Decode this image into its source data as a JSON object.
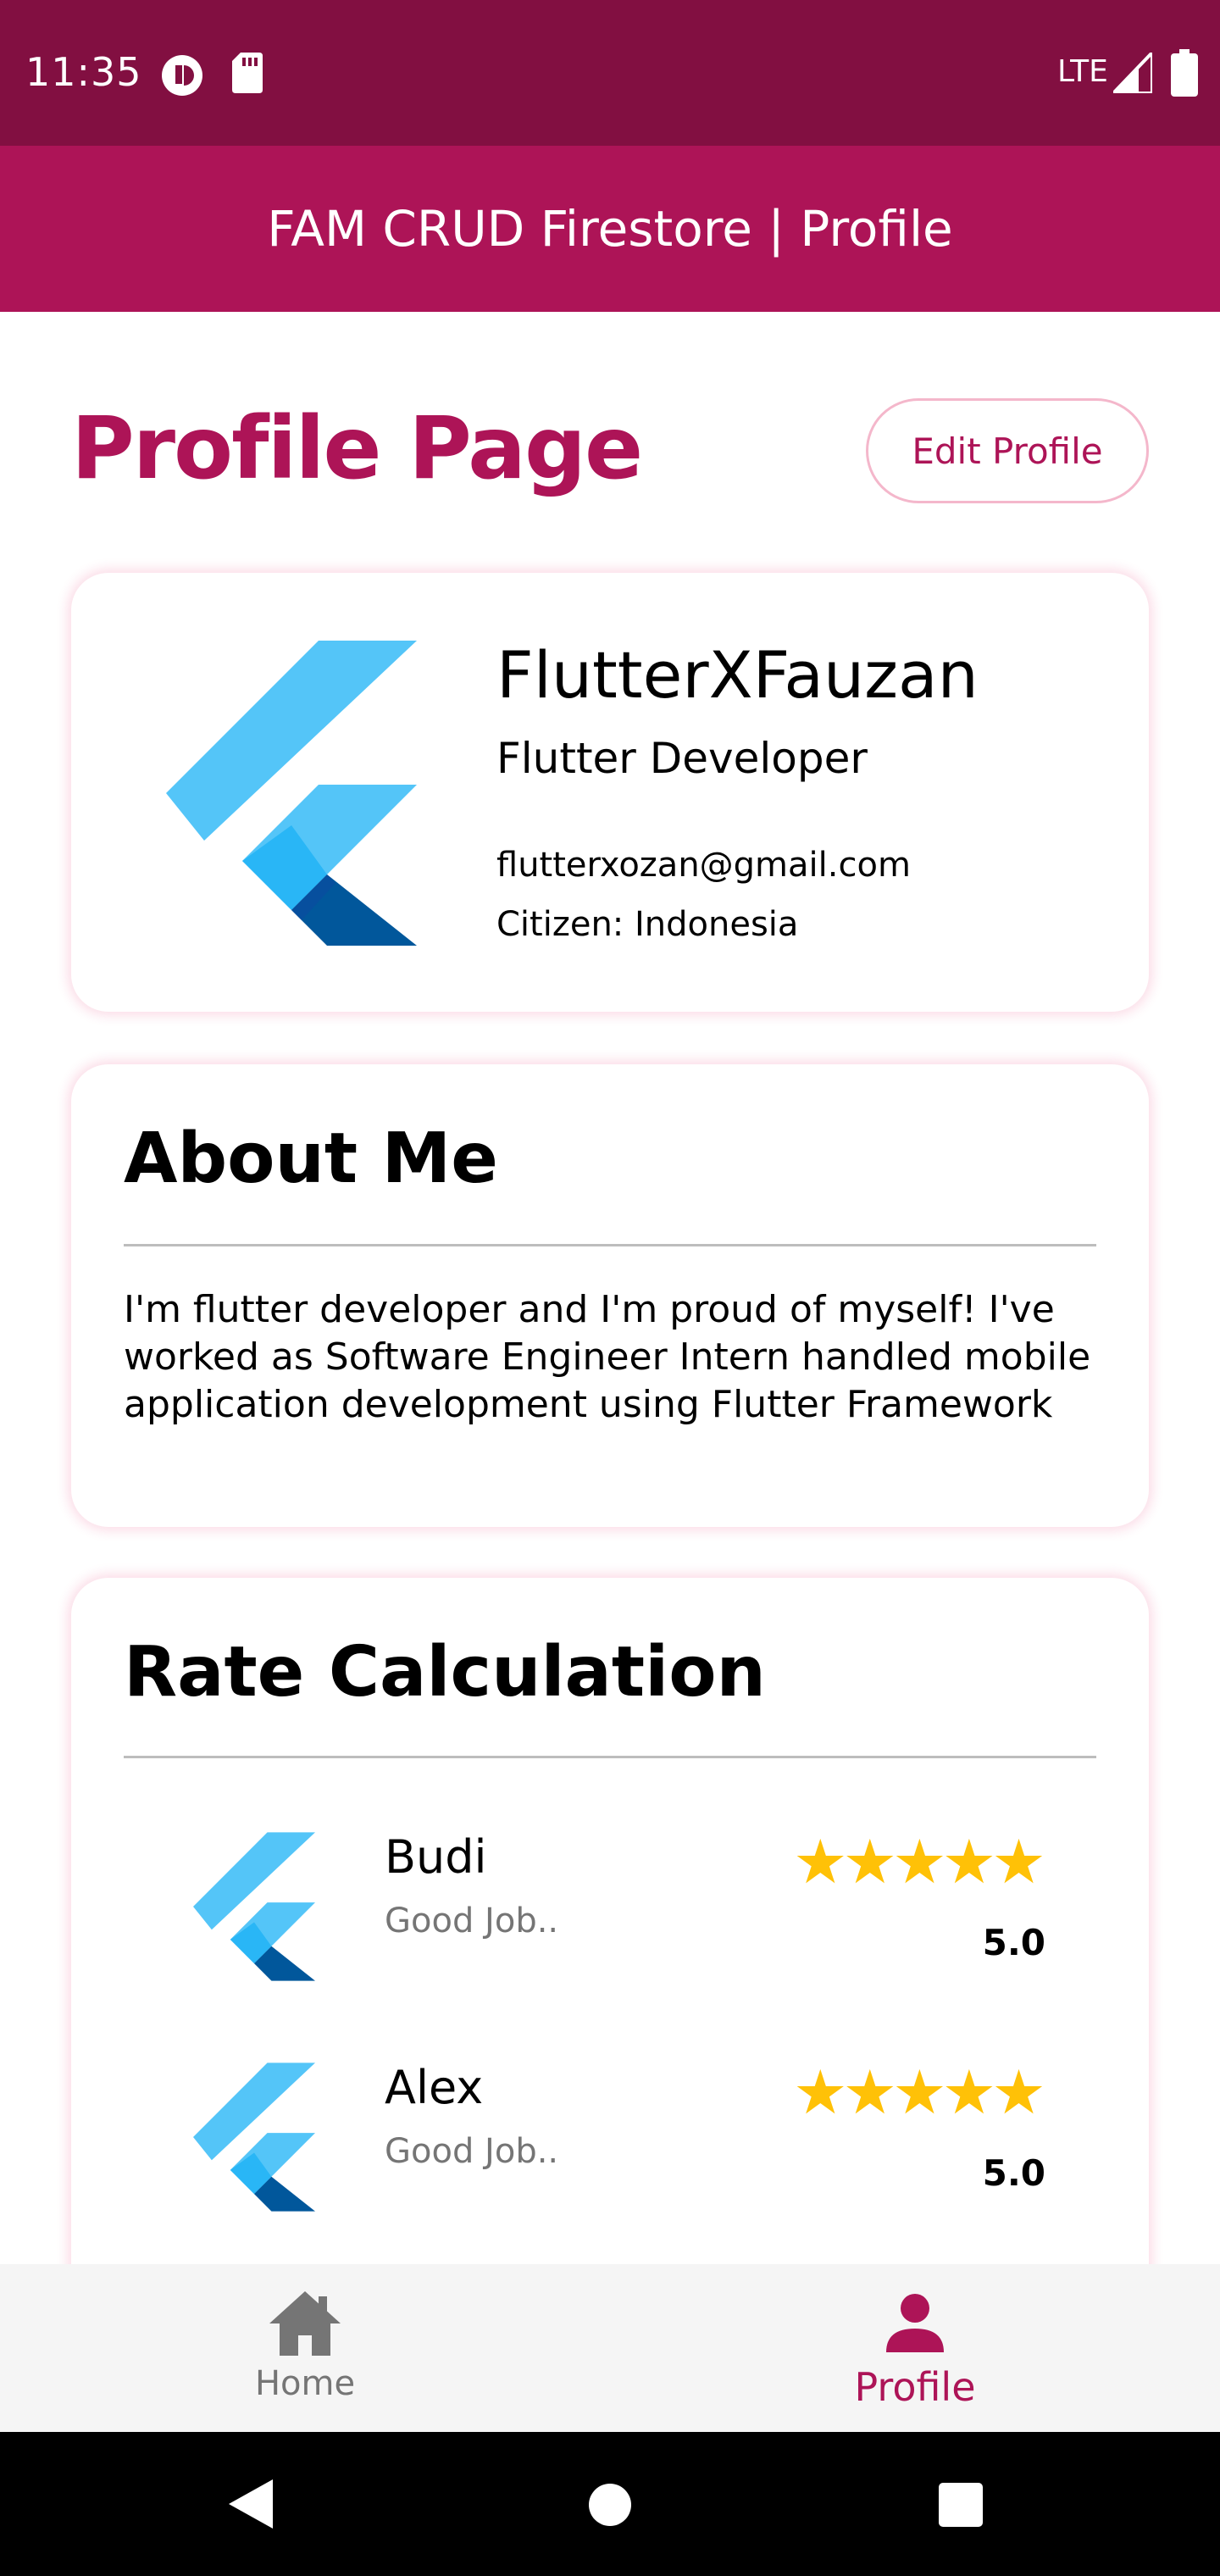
{
  "status_bar": {
    "time": "11:35",
    "network": "LTE",
    "icons": [
      "notification-icon",
      "sd-card-icon",
      "signal-icon",
      "battery-icon"
    ]
  },
  "app_bar": {
    "title": "FAM CRUD Firestore | Profile"
  },
  "page": {
    "title": "Profile Page",
    "edit_button": "Edit Profile"
  },
  "profile": {
    "name": "FlutterXFauzan",
    "role": "Flutter Developer",
    "email": "flutterxozan@gmail.com",
    "citizen": "Citizen: Indonesia",
    "avatar_icon": "flutter-logo-icon"
  },
  "about": {
    "title": "About Me",
    "text": "I'm flutter developer and I'm proud of myself! I've worked as Software Engineer Intern handled mobile application development using Flutter Framework"
  },
  "rate": {
    "title": "Rate Calculation",
    "reviews": [
      {
        "name": "Budi",
        "comment": "Good Job..",
        "stars": "★★★★★",
        "rating": "5.0"
      },
      {
        "name": "Alex",
        "comment": "Good Job..",
        "stars": "★★★★★",
        "rating": "5.0"
      }
    ]
  },
  "bottom_nav": {
    "items": [
      {
        "label": "Home",
        "icon": "home-icon"
      },
      {
        "label": "Profile",
        "icon": "person-icon"
      }
    ],
    "active": "Profile"
  },
  "colors": {
    "status_bar": "#820F41",
    "primary": "#AD1457",
    "star": "#FFC107",
    "nav_background": "#F5F5F5"
  }
}
